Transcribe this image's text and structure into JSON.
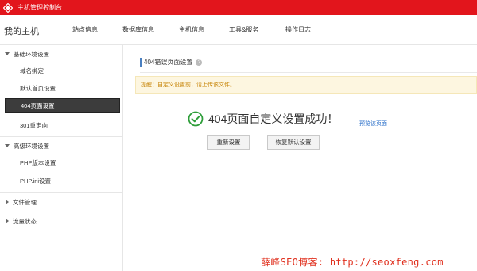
{
  "titlebar": {
    "title": "主机管理控制台"
  },
  "nav": {
    "home": "我的主机",
    "tabs": [
      {
        "label": "站点信息"
      },
      {
        "label": "数据库信息"
      },
      {
        "label": "主机信息"
      },
      {
        "label": "工具&服务"
      },
      {
        "label": "操作日志"
      }
    ]
  },
  "sidebar": {
    "group_basic": "基础环境设置",
    "basic_items": [
      {
        "label": "域名绑定"
      },
      {
        "label": "默认首页设置"
      },
      {
        "label": "404页面设置"
      },
      {
        "label": "301重定向"
      }
    ],
    "group_advanced": "高级环境设置",
    "advanced_items": [
      {
        "label": "PHP版本设置"
      },
      {
        "label": "PHP.ini设置"
      }
    ],
    "group_files": "文件管理",
    "group_traffic": "流量状态"
  },
  "main": {
    "section_title": "404错误页面设置",
    "notice": "提醒：自定义设置前，请上传该文件。",
    "success_message": "404页面自定义设置成功！",
    "preview_link": "预览该页面",
    "reset_button": "重新设置",
    "restore_button": "恢复默认设置"
  },
  "watermark": "薛峰SEO博客: http://seoxfeng.com",
  "colors": {
    "brand": "#e2151c",
    "success": "#2e9e3a",
    "link": "#2a6fc9",
    "notice_text": "#c8860a"
  }
}
